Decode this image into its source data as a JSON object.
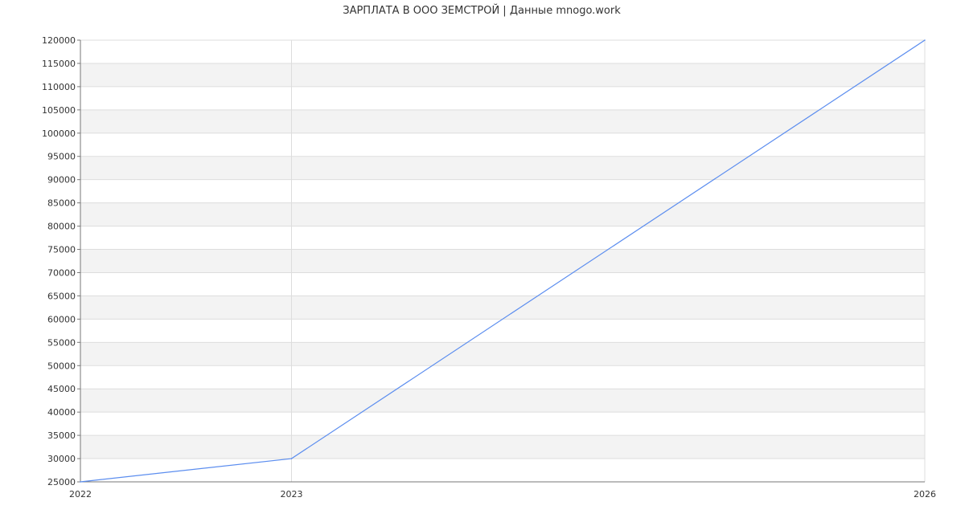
{
  "chart_data": {
    "type": "line",
    "title": "ЗАРПЛАТА В ООО ЗЕМСТРОЙ | Данные mnogo.work",
    "xlabel": "",
    "ylabel": "",
    "x": [
      "2022",
      "2023",
      "2026"
    ],
    "series": [
      {
        "values": [
          25000,
          30000,
          120000
        ]
      }
    ],
    "ylim": [
      25000,
      120000
    ],
    "y_ticks": [
      25000,
      30000,
      35000,
      40000,
      45000,
      50000,
      55000,
      60000,
      65000,
      70000,
      75000,
      80000,
      85000,
      90000,
      95000,
      100000,
      105000,
      110000,
      115000,
      120000
    ],
    "grid": true,
    "line_color": "#5b8def",
    "band_color": "#f3f3f3",
    "grid_color": "#dddddd",
    "axis_color": "#777777"
  }
}
